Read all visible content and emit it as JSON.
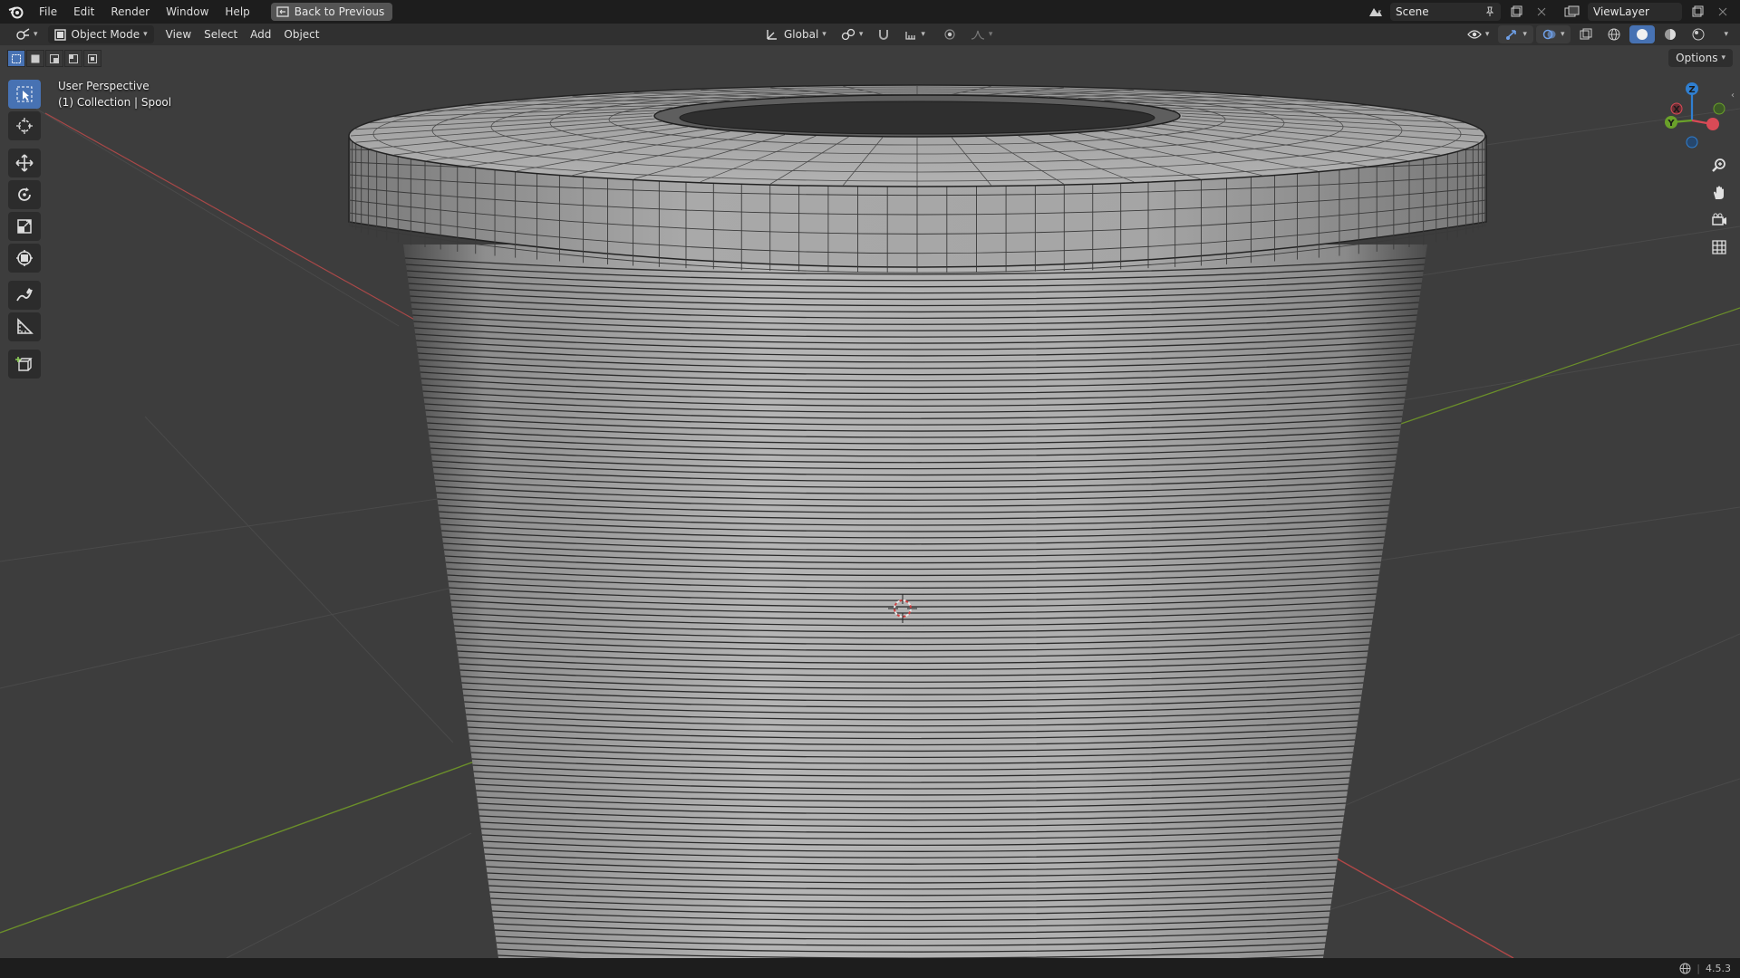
{
  "menu": {
    "items": [
      "File",
      "Edit",
      "Render",
      "Window",
      "Help"
    ],
    "back_button": "Back to Previous"
  },
  "top_right": {
    "scene": "Scene",
    "view_layer": "ViewLayer"
  },
  "header": {
    "mode": "Object Mode",
    "menus": [
      "View",
      "Select",
      "Add",
      "Object"
    ],
    "transform_orientation": "Global"
  },
  "options_label": "Options",
  "viewport": {
    "view_name": "User Perspective",
    "collection_info": "(1) Collection | Spool"
  },
  "gizmo": {
    "z_label": "Z",
    "x_label": "X",
    "y_label": "Y"
  },
  "status": {
    "version": "4.5.3"
  },
  "icons": {
    "logo": "blender-logo-icon",
    "tools": [
      "select-box-icon",
      "cursor-icon",
      "move-icon",
      "rotate-icon",
      "scale-icon",
      "transform-icon",
      "annotate-icon",
      "measure-icon",
      "add-cube-icon"
    ],
    "nav": [
      "zoom-icon",
      "pan-hand-icon",
      "camera-icon",
      "grid-icon"
    ]
  },
  "colors": {
    "accent": "#4772b3",
    "x_axis": "#d94a56",
    "y_axis": "#6aa12a",
    "z_axis": "#2f7fd1",
    "viewport_bg": "#3d3d3d"
  }
}
